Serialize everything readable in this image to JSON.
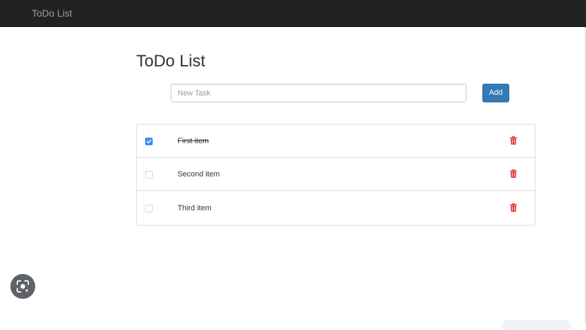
{
  "navbar": {
    "brand": "ToDo List"
  },
  "main": {
    "title": "ToDo List",
    "new_task": {
      "placeholder": "New Task",
      "value": ""
    },
    "add_label": "Add"
  },
  "todos": [
    {
      "text": "First item",
      "done": true
    },
    {
      "text": "Second item",
      "done": false
    },
    {
      "text": "Third item",
      "done": false
    }
  ],
  "icons": {
    "delete": "trash-icon",
    "lens": "lens-icon"
  },
  "colors": {
    "navbar_bg": "#222222",
    "navbar_text": "#9d9d9d",
    "primary": "#337ab7",
    "checkbox_checked": "#3c8ee8",
    "danger": "#e8302d"
  }
}
